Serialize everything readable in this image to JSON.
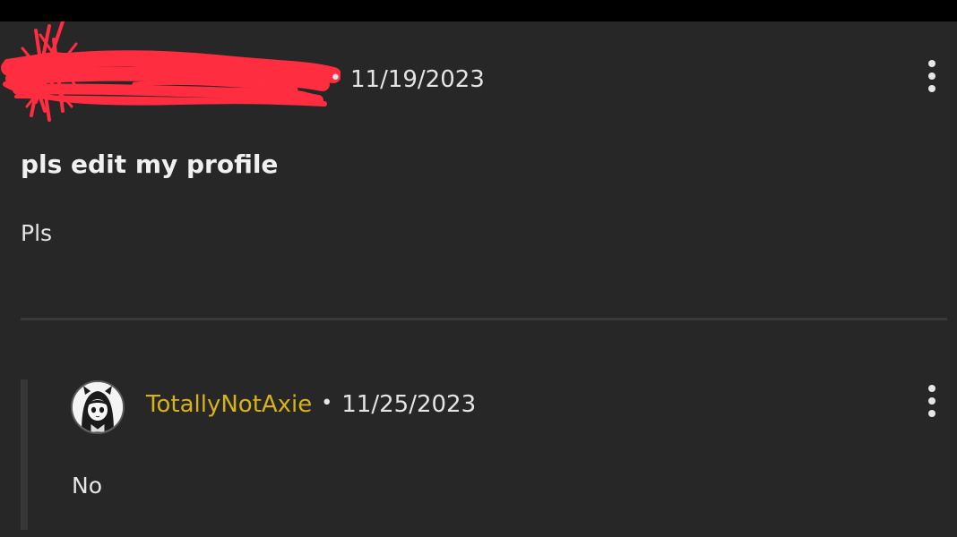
{
  "post": {
    "author_redacted": "",
    "date": "11/19/2023",
    "separator": "•",
    "title": "pls edit my profile",
    "body": "Pls"
  },
  "reply": {
    "username": "TotallyNotAxie",
    "separator": "•",
    "date": "11/25/2023",
    "body": "No"
  },
  "icons": {
    "post_menu": "more-vertical-icon",
    "reply_menu": "more-vertical-icon",
    "avatar": "avatar-image"
  },
  "colors": {
    "background": "#272727",
    "username": "#d6b21c",
    "redaction": "#ff2d3f",
    "text": "#e6e6e6"
  }
}
